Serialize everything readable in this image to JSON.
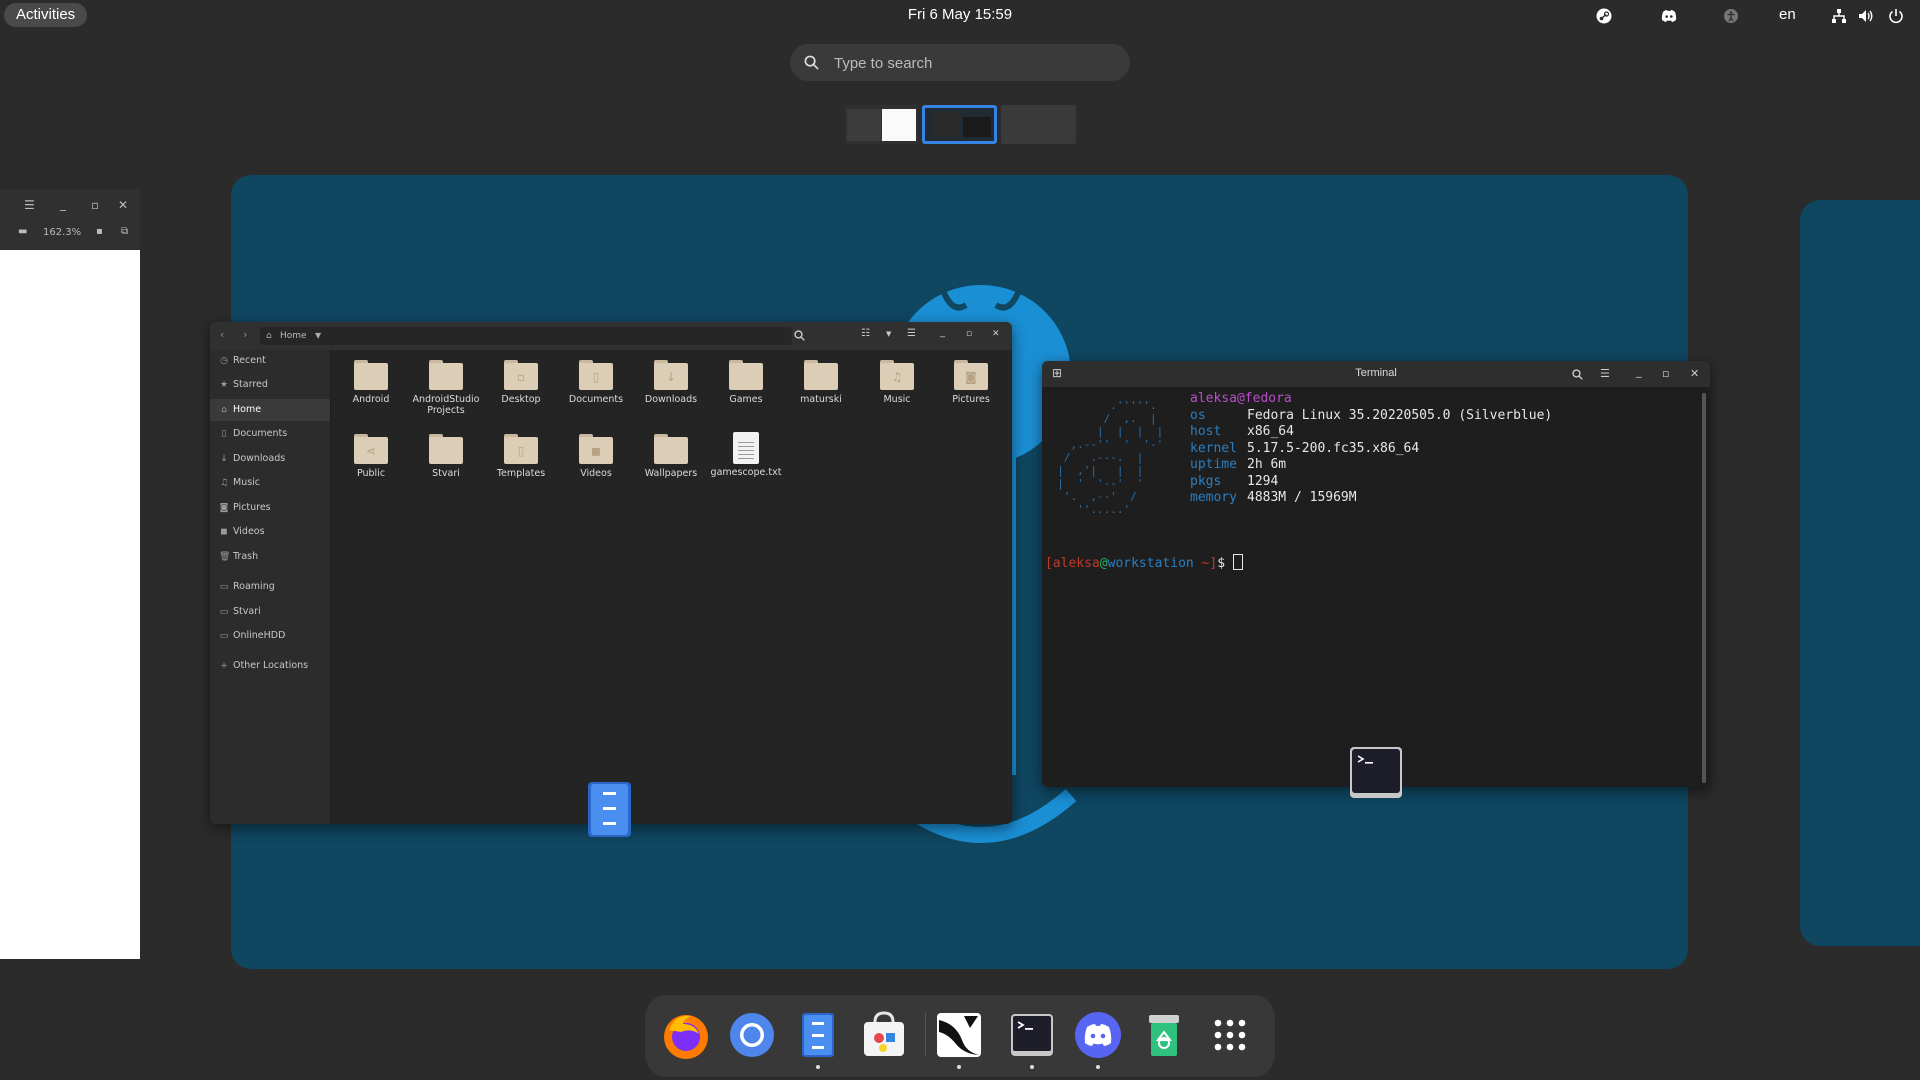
{
  "topbar": {
    "activities_label": "Activities",
    "clock": "Fri 6 May  15:59",
    "language": "en",
    "tray_icons": [
      "steam-icon",
      "discord-icon",
      "accessibility-icon",
      "network-icon",
      "volume-icon",
      "power-icon"
    ]
  },
  "search": {
    "placeholder": "Type to search"
  },
  "left_window": {
    "zoom": "162.3%"
  },
  "files": {
    "path_label": "Home",
    "sidebar": [
      {
        "label": "Recent",
        "icon": "clock-icon"
      },
      {
        "label": "Starred",
        "icon": "star-icon"
      },
      {
        "label": "Home",
        "icon": "home-icon",
        "selected": true
      },
      {
        "label": "Documents",
        "icon": "document-icon"
      },
      {
        "label": "Downloads",
        "icon": "download-icon"
      },
      {
        "label": "Music",
        "icon": "music-icon"
      },
      {
        "label": "Pictures",
        "icon": "picture-icon"
      },
      {
        "label": "Videos",
        "icon": "video-icon"
      },
      {
        "label": "Trash",
        "icon": "trash-icon"
      },
      {
        "label": "Roaming",
        "icon": "drive-icon"
      },
      {
        "label": "Stvari",
        "icon": "drive-icon"
      },
      {
        "label": "OnlineHDD",
        "icon": "drive-icon"
      },
      {
        "label": "Other Locations",
        "icon": "plus-icon"
      }
    ],
    "items": [
      {
        "label": "Android",
        "type": "folder"
      },
      {
        "label": "AndroidStudio Projects",
        "type": "folder"
      },
      {
        "label": "Desktop",
        "type": "folder"
      },
      {
        "label": "Documents",
        "type": "folder"
      },
      {
        "label": "Downloads",
        "type": "folder"
      },
      {
        "label": "Games",
        "type": "folder"
      },
      {
        "label": "maturski",
        "type": "folder"
      },
      {
        "label": "Music",
        "type": "folder"
      },
      {
        "label": "Pictures",
        "type": "folder"
      },
      {
        "label": "Public",
        "type": "folder"
      },
      {
        "label": "Stvari",
        "type": "folder"
      },
      {
        "label": "Templates",
        "type": "folder"
      },
      {
        "label": "Videos",
        "type": "folder"
      },
      {
        "label": "Wallpapers",
        "type": "folder"
      },
      {
        "label": "gamescope.txt",
        "type": "file"
      }
    ]
  },
  "terminal": {
    "title": "Terminal",
    "user_host": "aleksa@fedora",
    "fetch": [
      {
        "key": "os",
        "value": "Fedora Linux 35.20220505.0 (Silverblue)"
      },
      {
        "key": "host",
        "value": "x86_64"
      },
      {
        "key": "kernel",
        "value": "5.17.5-200.fc35.x86_64"
      },
      {
        "key": "uptime",
        "value": "2h 6m"
      },
      {
        "key": "pkgs",
        "value": "1294"
      },
      {
        "key": "memory",
        "value": "4883M / 15969M"
      }
    ],
    "prompt_user": "aleksa",
    "prompt_at": "@",
    "prompt_host": "workstation",
    "prompt_dir": "~",
    "prompt_symbol": "$"
  },
  "dock": {
    "apps": [
      "firefox-icon",
      "chromium-icon",
      "files-icon",
      "software-icon",
      "inkscape-icon",
      "terminal-icon",
      "discord-icon",
      "trash-app-icon",
      "show-apps-icon"
    ]
  }
}
